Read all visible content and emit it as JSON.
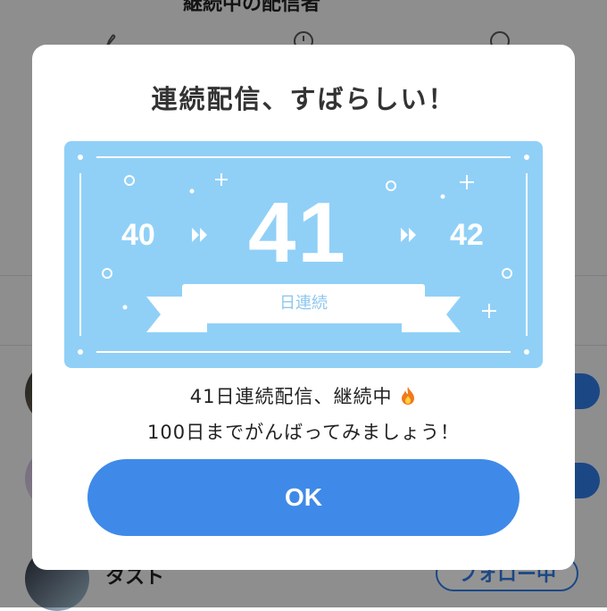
{
  "background": {
    "header_title": "継続中の配信者",
    "rows": [
      {
        "name": ""
      },
      {
        "name": ""
      },
      {
        "name": "タスト",
        "follow_label": "フォロー中"
      }
    ]
  },
  "modal": {
    "title": "連続配信、すばらしい！",
    "streak": {
      "previous": "40",
      "current": "41",
      "next": "42",
      "ribbon_label": "日連続"
    },
    "message_line1": "41日連続配信、継続中",
    "message_line2": "100日までがんばってみましょう！",
    "ok_label": "OK"
  },
  "colors": {
    "card": "#90d0f7",
    "ok_button": "#3f8ae8",
    "overlay": "rgba(0,0,0,0.42)"
  },
  "icons": [
    "paint-icon",
    "clock-icon",
    "search-icon",
    "double-chevron-right-icon",
    "fire-icon"
  ]
}
